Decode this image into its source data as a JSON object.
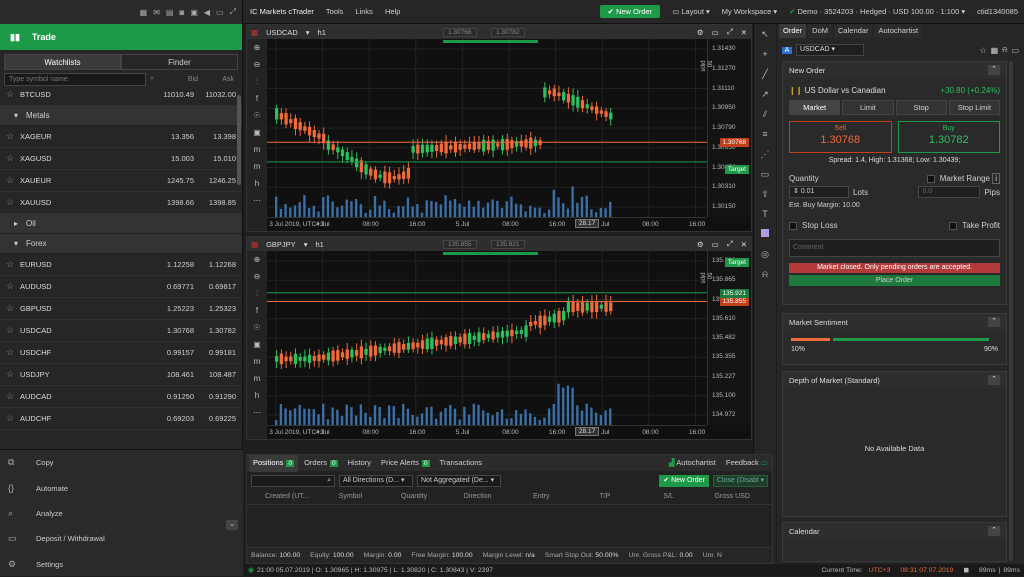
{
  "left": {
    "tabs": [
      "Watchlists",
      "Finder"
    ],
    "trade_label": "Trade",
    "search_placeholder": "Type symbol name",
    "bid_header": "Bid",
    "ask_header": "Ask",
    "rows_top": [
      {
        "name": "BTCUSD",
        "bid": "11010.49",
        "ask": "11032.00"
      }
    ],
    "groups": [
      {
        "name": "Metals",
        "rows": [
          {
            "name": "XAGEUR",
            "bid": "13.356",
            "ask": "13.398"
          },
          {
            "name": "XAGUSD",
            "bid": "15.003",
            "ask": "15.010"
          },
          {
            "name": "XAUEUR",
            "bid": "1245.75",
            "ask": "1246.25"
          },
          {
            "name": "XAUUSD",
            "bid": "1398.66",
            "ask": "1398.85"
          }
        ]
      },
      {
        "name": "Oil",
        "rows": []
      },
      {
        "name": "Forex",
        "rows": [
          {
            "name": "EURUSD",
            "bid": "1.12258",
            "ask": "1.12268"
          },
          {
            "name": "AUDUSD",
            "bid": "0.69771",
            "ask": "0.69817"
          },
          {
            "name": "GBPUSD",
            "bid": "1.25223",
            "ask": "1.25323"
          },
          {
            "name": "USDCAD",
            "bid": "1.30768",
            "ask": "1.30782"
          },
          {
            "name": "USDCHF",
            "bid": "0.99157",
            "ask": "0.99181"
          },
          {
            "name": "USDJPY",
            "bid": "108.461",
            "ask": "108.487"
          },
          {
            "name": "AUDCAD",
            "bid": "0.91250",
            "ask": "0.91290"
          },
          {
            "name": "AUDCHF",
            "bid": "0.69203",
            "ask": "0.69225"
          },
          {
            "name": "AUDJPY",
            "bid": "75.694",
            "ask": "75.726"
          }
        ]
      }
    ],
    "menu": [
      "Copy",
      "Automate",
      "Analyze",
      "Deposit / Withdrawal",
      "Settings"
    ]
  },
  "topbar": {
    "title": "IC Markets cTrader",
    "menus": [
      "Tools",
      "Links",
      "Help"
    ],
    "new_order": "New Order",
    "layout": "Layout",
    "workspace": "My Workspace",
    "account": "Demo · 3524203 · Hedged · USD 100.00 · 1:100",
    "ctid": "ctid1340085"
  },
  "chart1": {
    "symbol": "USDCAD",
    "tf": "h1",
    "bid_box": "1.30768",
    "ask_box": "1.30782",
    "yticks": [
      "1.31430",
      "1.31270",
      "1.31110",
      "1.30950",
      "1.30790",
      "1.30630",
      "1.30470",
      "1.30310",
      "1.30150"
    ],
    "price_tag": "1.30768",
    "target_tag": "Target",
    "pips_label": "50 pips",
    "xticks": [
      "3 Jul 2019, UTC+3",
      "4 Jul",
      "08:00",
      "16:00",
      "5 Jul",
      "08:00",
      "16:00",
      "6 Jul",
      "08:00",
      "16:00"
    ],
    "cursor_label": "28.17"
  },
  "chart2": {
    "symbol": "GBPJPY",
    "tf": "h1",
    "bid_box": "135.855",
    "ask_box": "135.921",
    "yticks": [
      "135.992",
      "135.865",
      "135.737",
      "135.610",
      "135.482",
      "135.355",
      "135.227",
      "135.100",
      "134.972"
    ],
    "price_tag": "135.855",
    "price_tag2": "135.921",
    "target_tag": "Target",
    "pips_label": "50 pips",
    "xticks": [
      "3 Jul 2019, UTC+3",
      "4 Jul",
      "08:00",
      "16:00",
      "5 Jul",
      "08:00",
      "16:00",
      "6 Jul",
      "08:00",
      "16:00"
    ],
    "cursor_label": "28.17"
  },
  "bottom": {
    "tabs": [
      {
        "label": "Positions",
        "badge": "0"
      },
      {
        "label": "Orders",
        "badge": "0"
      },
      {
        "label": "History"
      },
      {
        "label": "Price Alerts",
        "badge": "0"
      },
      {
        "label": "Transactions"
      }
    ],
    "autochartist": "Autochartist",
    "feedback": "Feedback",
    "filter1": "All Directions (D...",
    "filter2": "Not Aggregated (De...",
    "new_order": "New Order",
    "close_disabled": "Close (Disabl",
    "columns": [
      "Created  (UT...",
      "Symbol",
      "Quantity",
      "Direction",
      "Entry",
      "T/P",
      "S/L",
      "Gross USD"
    ],
    "stats": [
      {
        "k": "Balance:",
        "v": "100.00"
      },
      {
        "k": "Equity:",
        "v": "100.00"
      },
      {
        "k": "Margin:",
        "v": "0.00"
      },
      {
        "k": "Free Margin:",
        "v": "100.00"
      },
      {
        "k": "Margin Level:",
        "v": "n/a"
      },
      {
        "k": "Smart Stop Out:",
        "v": "50.00%"
      },
      {
        "k": "Unr. Gross P&L:",
        "v": "0.00"
      },
      {
        "k": "Unr. N",
        "v": ""
      }
    ]
  },
  "status": {
    "ohlc": "21:00 05.07.2019 | O: 1.30965 | H: 1.30975 | L: 1.30820 | C: 1.30843 | V: 2397",
    "current_time_label": "Current Time:",
    "tz": "UTC+3",
    "time": "08:31 07.07.2019",
    "ping1": "89ms",
    "ping2": "89ms"
  },
  "right": {
    "tabs": [
      "Order",
      "DoM",
      "Calendar",
      "Autochartist"
    ],
    "symbol": "USDCAD",
    "new_order_title": "New Order",
    "instrument": "US Dollar vs Canadian",
    "change": "+30.80 (+0.24%)",
    "order_types": [
      "Market",
      "Limit",
      "Stop",
      "Stop Limit"
    ],
    "sell_label": "Sell",
    "sell_price": "1.30768",
    "buy_label": "Buy",
    "buy_price": "1.30782",
    "spread": "Spread: 1.4, High: 1.31368; Low: 1.30439;",
    "quantity_label": "Quantity",
    "quantity": "0.01",
    "lots": "Lots",
    "market_range": "Market Range",
    "mr_value": "0.0",
    "pips": "Pips",
    "margin": "Est. Buy Margin: 10.00",
    "stop_loss": "Stop Loss",
    "take_profit": "Take Profit",
    "comment_placeholder": "Comment",
    "closed_msg": "Market closed. Only pending orders are accepted.",
    "place_order": "Place Order",
    "sentiment_title": "Market Sentiment",
    "sent_sell": "10%",
    "sent_buy": "90%",
    "sent_sell_fraction": 0.1,
    "dom_title": "Depth of Market (Standard)",
    "dom_empty": "No Available Data",
    "calendar_title": "Calendar"
  }
}
